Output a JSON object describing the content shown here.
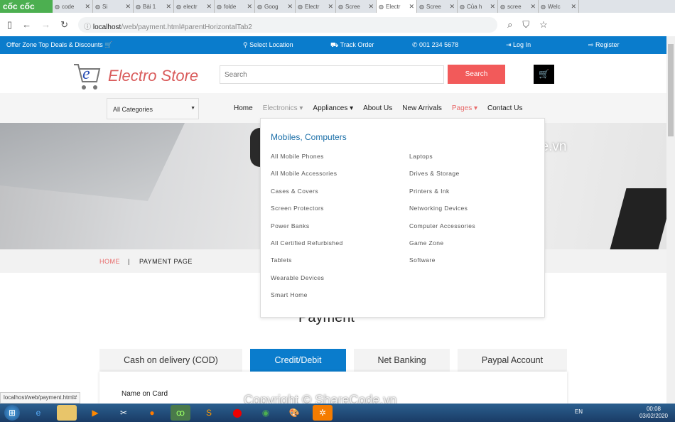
{
  "browser": {
    "brand": "cốc cốc",
    "tabs": [
      "code",
      "Si",
      "Bài 1",
      "electr",
      "folde",
      "Goog",
      "Electr",
      "Scree",
      "Electr",
      "Scree",
      "Của h",
      "scree",
      "Welc"
    ],
    "active_tab": 8,
    "url_host": "localhost",
    "url_path": "/web/payment.html#parentHorizontalTab2"
  },
  "topbar": {
    "offer": "Offer Zone Top Deals & Discounts",
    "select_location": "Select Location",
    "track_order": "Track Order",
    "phone": "001 234 5678",
    "login": "Log In",
    "register": "Register"
  },
  "header": {
    "logo_text": "Electro Store",
    "search_placeholder": "Search",
    "search_button": "Search"
  },
  "nav": {
    "category": "All Categories",
    "items": [
      "Home",
      "Electronics ▾",
      "Appliances ▾",
      "About Us",
      "New Arrivals",
      "Pages ▾",
      "Contact Us"
    ]
  },
  "dropdown": {
    "title": "Mobiles, Computers",
    "col1": [
      "All Mobile Phones",
      "All Mobile Accessories",
      "Cases & Covers",
      "Screen Protectors",
      "Power Banks",
      "All Certified Refurbished",
      "Tablets",
      "Wearable Devices",
      "Smart Home"
    ],
    "col2": [
      "Laptops",
      "Drives & Storage",
      "Printers & Ink",
      "Networking Devices",
      "Computer Accessories",
      "Game Zone",
      "Software"
    ]
  },
  "breadcrumb": {
    "home": "HOME",
    "sep": "|",
    "current": "PAYMENT PAGE"
  },
  "payment": {
    "title": "Payment",
    "tabs": [
      "Cash on delivery (COD)",
      "Credit/Debit",
      "Net Banking",
      "Paypal Account"
    ],
    "active": "Credit/Debit",
    "name_on_card": "Name on Card"
  },
  "status_url": "localhost/web/payment.html#",
  "taskbar": {
    "lang": "EN",
    "time": "00:08",
    "date": "03/02/2020"
  },
  "watermarks": {
    "top": "ShareCode.vn",
    "bottom": "Copyright © ShareCode.vn",
    "logo": "SHARECODE.vn"
  },
  "colors": {
    "primary": "#0a7ccc",
    "accent": "#f25a5a"
  }
}
